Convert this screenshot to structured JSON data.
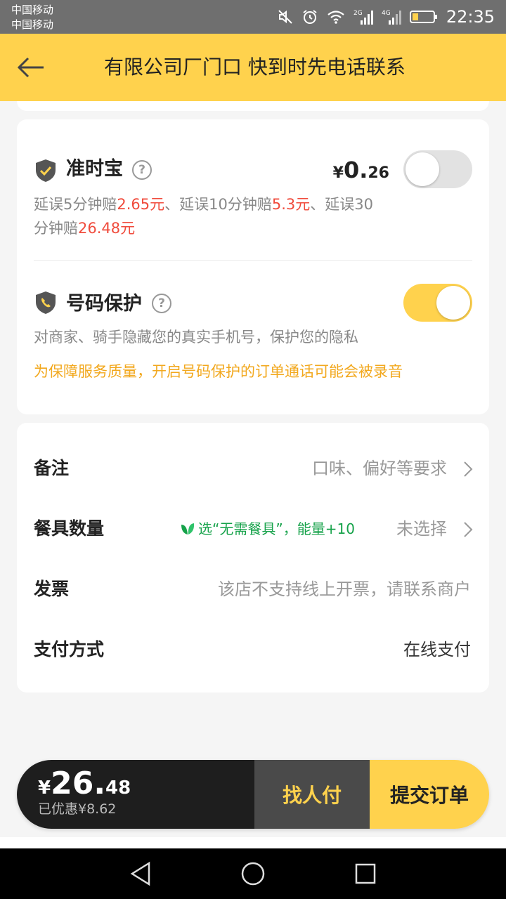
{
  "status_bar": {
    "carrier1": "中国移动",
    "carrier2": "中国移动",
    "net1": "2G",
    "net2": "4G",
    "time": "22:35"
  },
  "header": {
    "title": "有限公司厂门口 快到时先电话联系"
  },
  "on_time": {
    "title": "准时宝",
    "help": "?",
    "price_symbol": "¥",
    "price_int": "0.",
    "price_dec": "26",
    "toggle_on": false,
    "desc_p1": "延误5分钟赔",
    "desc_v1": "2.65元",
    "desc_p2": "、延误10分钟赔",
    "desc_v2": "5.3元",
    "desc_p3": "、延误30",
    "desc_p4": "分钟赔",
    "desc_v3": "26.48元"
  },
  "number_protect": {
    "title": "号码保护",
    "help": "?",
    "toggle_on": true,
    "desc": "对商家、骑手隐藏您的真实手机号，保护您的隐私",
    "notice": "为保障服务质量，开启号码保护的订单通话可能会被录音"
  },
  "rows": {
    "note_label": "备注",
    "note_value": "口味、偏好等要求",
    "tableware_label": "餐具数量",
    "tableware_promo": "选“无需餐具”，能量+10",
    "tableware_value": "未选择",
    "invoice_label": "发票",
    "invoice_value": "该店不支持线上开票，请联系商户",
    "payment_label": "支付方式",
    "payment_value": "在线支付"
  },
  "bottom": {
    "total_symbol": "¥",
    "total_int": "26.",
    "total_dec": "48",
    "discount": "已优惠¥8.62",
    "friend_pay": "找人付",
    "submit": "提交订单"
  },
  "colors": {
    "accent": "#ffd24d",
    "highlight_red": "#f04b3c",
    "notice_orange": "#f2a81e",
    "promo_green": "#16a24a"
  }
}
